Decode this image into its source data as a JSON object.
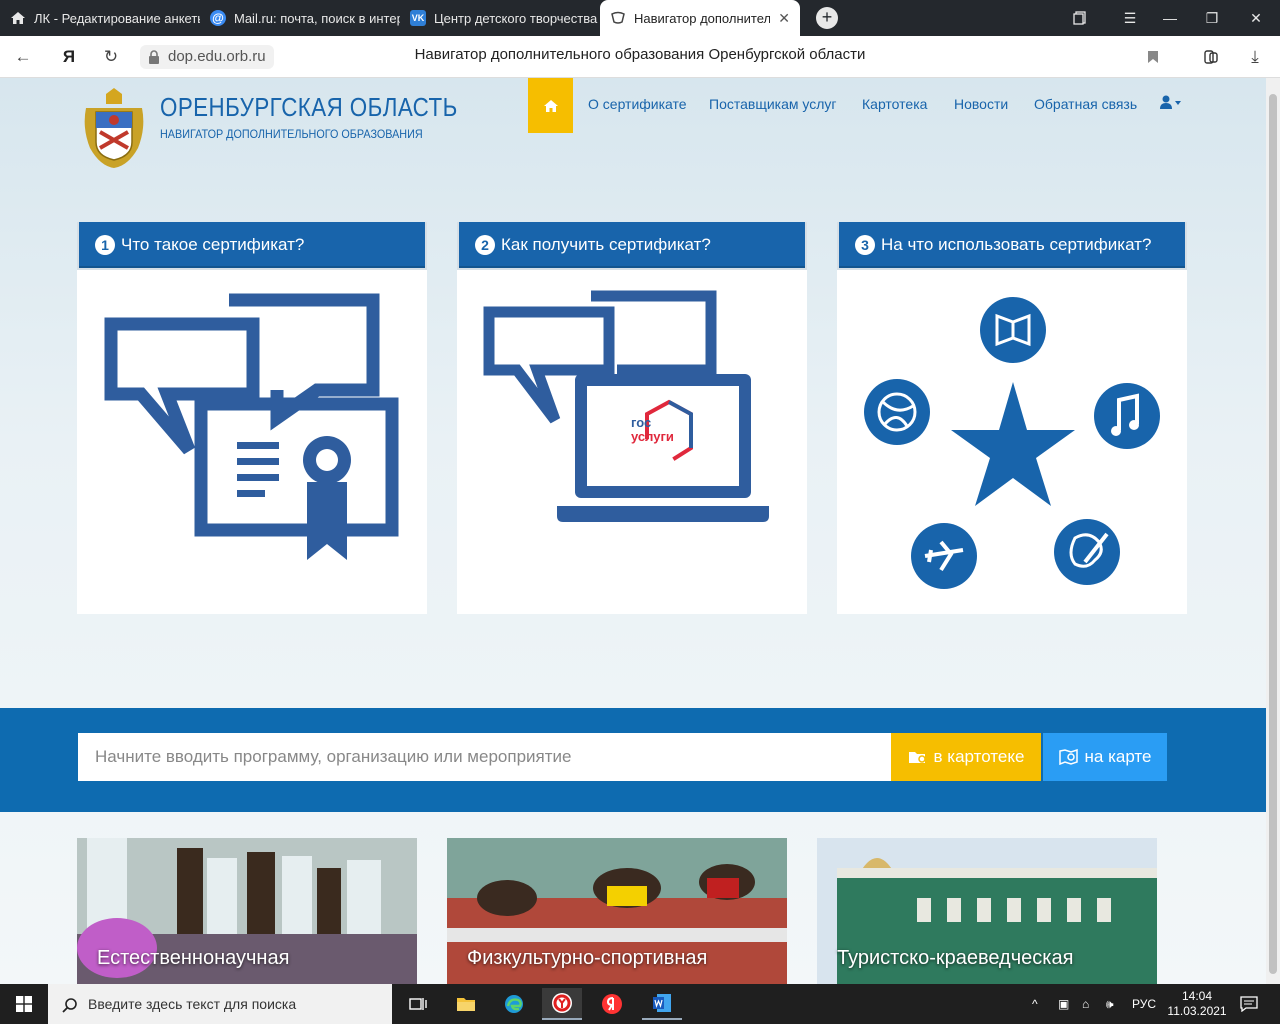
{
  "tabs": [
    {
      "title": "ЛК - Редактирование анкеты",
      "icon": "home-icon"
    },
    {
      "title": "Mail.ru: почта, поиск в интернете",
      "icon": "mail-at-icon"
    },
    {
      "title": "Центр детского творчества",
      "icon": "vk-icon"
    },
    {
      "title": "Навигатор дополнительного образования",
      "icon": "navigator-icon"
    }
  ],
  "addressbar": {
    "url": "dop.edu.orb.ru",
    "page_title": "Навигатор дополнительного образования Оренбургской области",
    "yandex": "Я"
  },
  "site": {
    "brand_title": "ОРЕНБУРГСКАЯ ОБЛАСТЬ",
    "brand_subtitle": "НАВИГАТОР ДОПОЛНИТЕЛЬНОГО ОБРАЗОВАНИЯ",
    "nav": [
      "О сертификате",
      "Поставщикам услуг",
      "Картотека",
      "Новости",
      "Обратная связь"
    ],
    "cards": [
      {
        "num": "1",
        "title": "Что такое сертификат?"
      },
      {
        "num": "2",
        "title": "Как получить сертификат?",
        "logo_line1": "гос",
        "logo_line2": "услуги"
      },
      {
        "num": "3",
        "title": "На что использовать сертификат?"
      }
    ],
    "search": {
      "placeholder": "Начните вводить программу, организацию или мероприятие",
      "catalog_btn": "в картотеке",
      "map_btn": "на карте"
    },
    "tiles": [
      "Естественнонаучная",
      "Физкультурно-спортивная",
      "Туристско-краеведческая"
    ]
  },
  "taskbar": {
    "search_placeholder": "Введите здесь текст для поиска",
    "lang": "РУС",
    "time": "14:04",
    "date": "11.03.2021"
  },
  "colors": {
    "brand_blue": "#1864ab",
    "accent_yellow": "#f6be00",
    "map_blue": "#2a9df4"
  }
}
